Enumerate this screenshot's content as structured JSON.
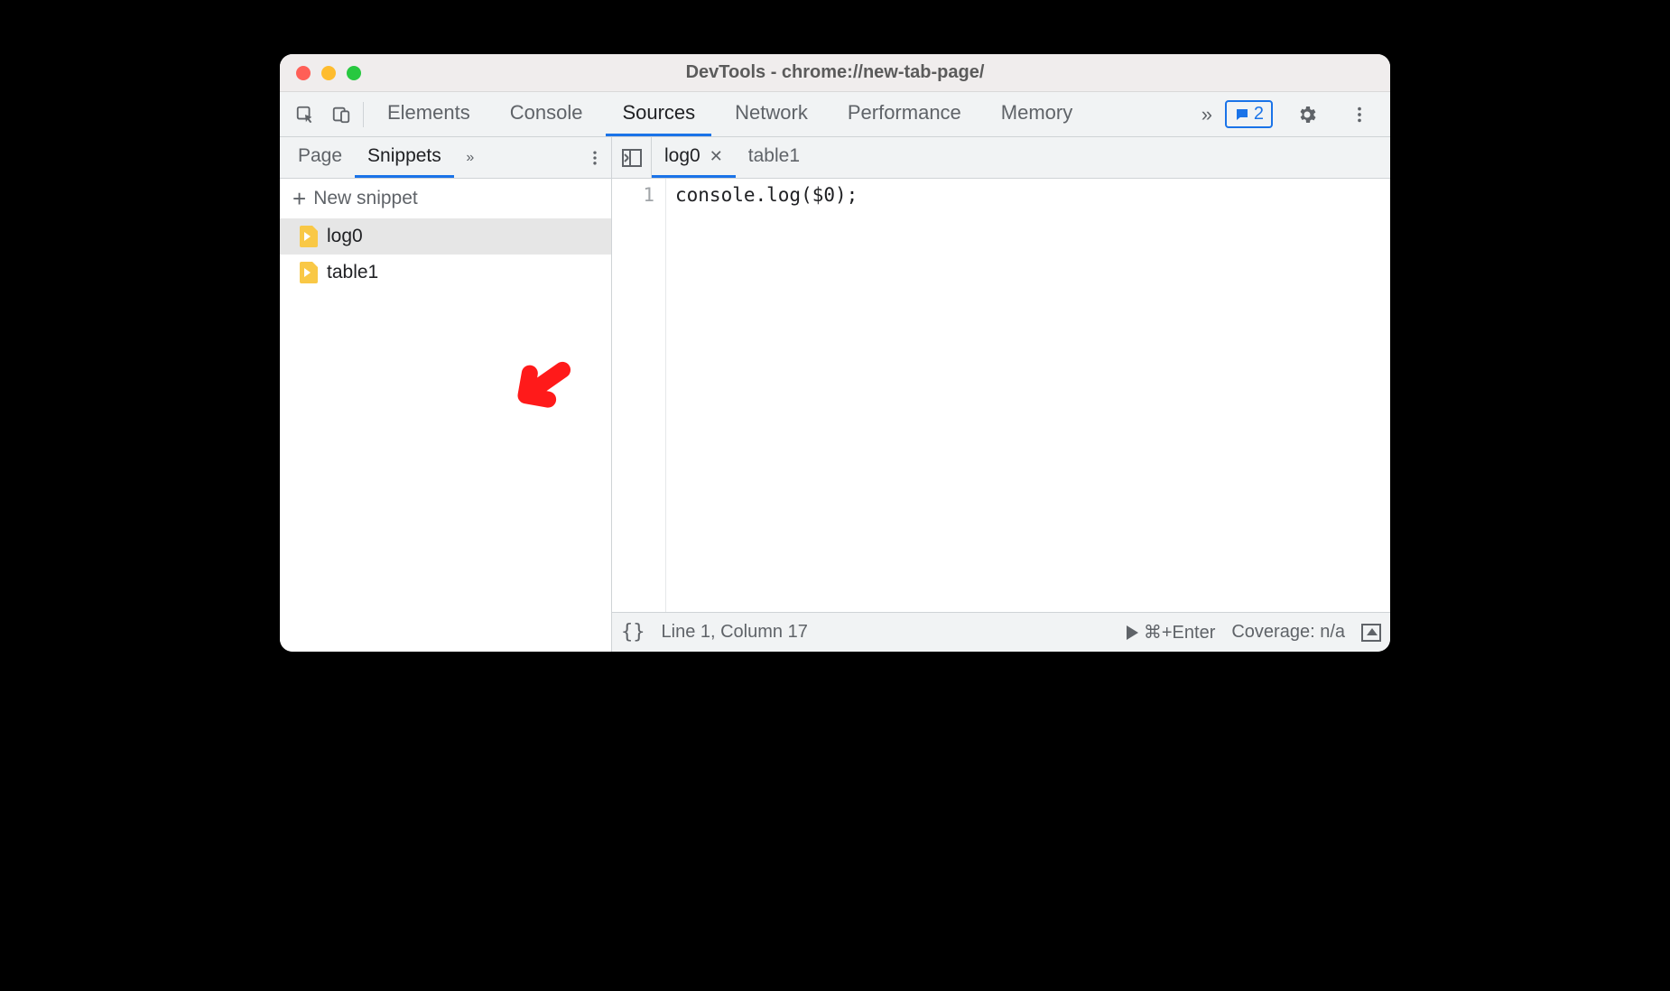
{
  "window": {
    "title": "DevTools - chrome://new-tab-page/"
  },
  "main_tabs": {
    "items": [
      "Elements",
      "Console",
      "Sources",
      "Network",
      "Performance",
      "Memory"
    ],
    "active_index": 2,
    "overflow_glyph": "»"
  },
  "messages_badge": {
    "count": "2"
  },
  "sidebar": {
    "subtabs": {
      "items": [
        "Page",
        "Snippets"
      ],
      "active_index": 1,
      "overflow_glyph": "»"
    },
    "new_snippet_label": "New snippet",
    "files": [
      {
        "name": "log0",
        "selected": true
      },
      {
        "name": "table1",
        "selected": false
      }
    ]
  },
  "editor": {
    "tabs": [
      {
        "name": "log0",
        "active": true,
        "closable": true
      },
      {
        "name": "table1",
        "active": false,
        "closable": false
      }
    ],
    "lines": [
      {
        "num": "1",
        "text": "console.log($0);"
      }
    ]
  },
  "statusbar": {
    "braces": "{}",
    "cursor": "Line 1, Column 17",
    "run_hint": "⌘+Enter",
    "coverage": "Coverage: n/a"
  },
  "annotation": {
    "kind": "red-arrow-pointing-down-left"
  }
}
